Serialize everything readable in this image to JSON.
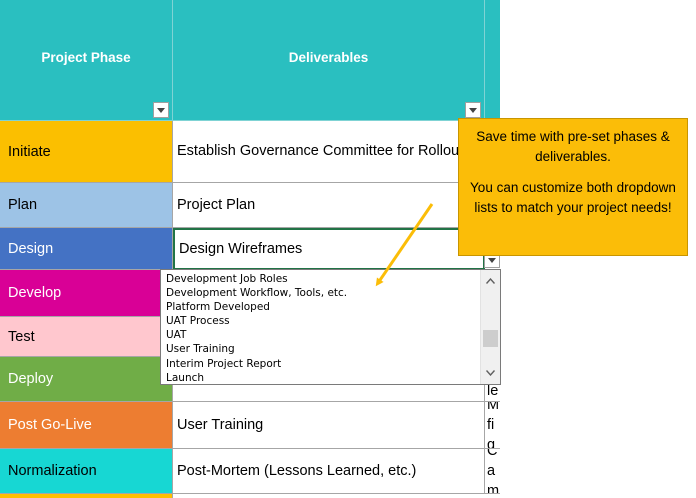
{
  "headers": {
    "phase": "Project Phase",
    "deliverables": "Deliverables"
  },
  "rows": [
    {
      "phase": "Initiate",
      "color": "#fbbf00",
      "deliverable": "Establish Governance Committee for Rollout",
      "third": "",
      "textcolor": "#000000"
    },
    {
      "phase": "Plan",
      "color": "#9dc3e6",
      "deliverable": "Project Plan",
      "third": "",
      "textcolor": "#000000"
    },
    {
      "phase": "Design",
      "color": "#4472c4",
      "deliverable": "Design Wireframes",
      "third": "",
      "textcolor": "#ffffff"
    },
    {
      "phase": "Develop",
      "color": "#d90096",
      "deliverable": "",
      "third": "",
      "textcolor": "#ffffff"
    },
    {
      "phase": "Test",
      "color": "#ffc7ce",
      "deliverable": "",
      "third": "",
      "textcolor": "#000000"
    },
    {
      "phase": "Deploy",
      "color": "#70ad47",
      "deliverable": "",
      "third": "le",
      "textcolor": "#ffffff"
    },
    {
      "phase": "Post Go-Live",
      "color": "#ed7d31",
      "deliverable": "User Training",
      "third": "M fig",
      "textcolor": "#ffffff"
    },
    {
      "phase": "Normalization",
      "color": "#17d7d3",
      "deliverable": "Post-Mortem (Lessons Learned, etc.)",
      "third": "Ca m",
      "textcolor": "#000000"
    }
  ],
  "dropdown_list": {
    "items": [
      "Development Job Roles",
      "Development Workflow, Tools, etc.",
      "Platform Developed",
      "UAT Process",
      "UAT",
      "User Training",
      "Interim Project Report",
      "Launch"
    ]
  },
  "callout": {
    "line1": "Save time with pre-set phases & deliverables.",
    "line2": "You can customize both dropdown lists to match your project needs!"
  },
  "colors": {
    "header": "#2abfc0",
    "callout": "#fbbd08"
  }
}
